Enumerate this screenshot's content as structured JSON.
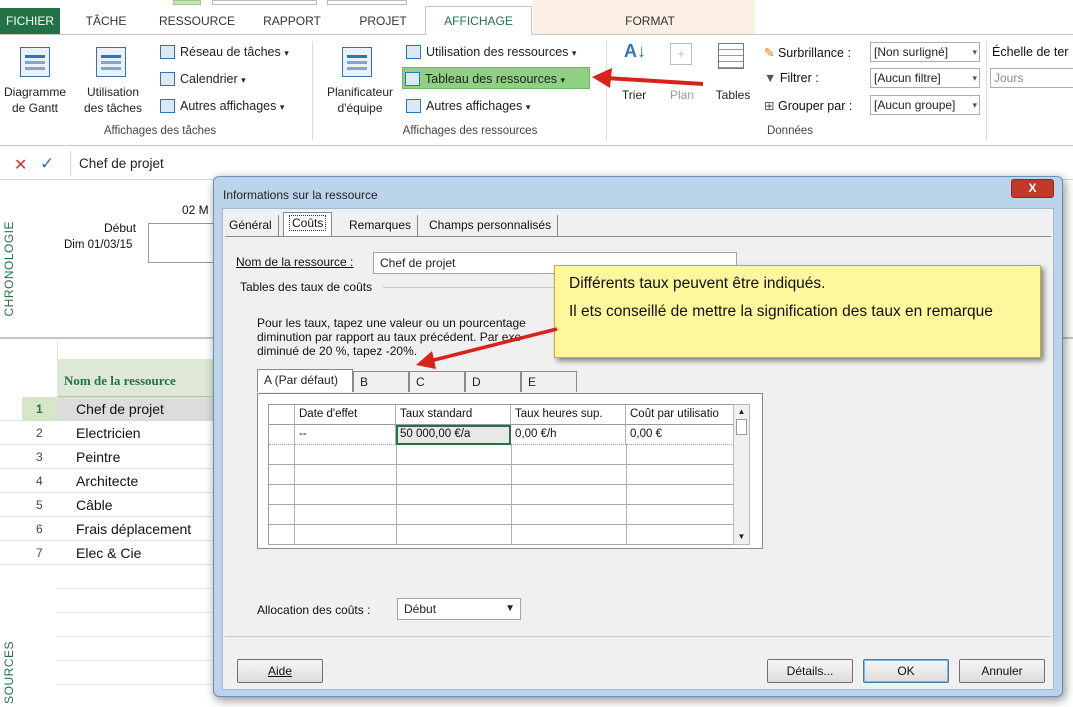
{
  "ribbon": {
    "tabs": [
      "FICHIER",
      "TÂCHE",
      "RESSOURCE",
      "RAPPORT",
      "PROJET",
      "AFFICHAGE",
      "FORMAT"
    ],
    "active_tab": "AFFICHAGE",
    "task_views": {
      "gantt": "Diagramme de Gantt",
      "usage": "Utilisation des tâches",
      "network": "Réseau de tâches",
      "calendar": "Calendrier",
      "other": "Autres affichages",
      "group_label": "Affichages des tâches"
    },
    "resource_views": {
      "planner": "Planificateur d'équipe",
      "usage": "Utilisation des ressources",
      "sheet": "Tableau des ressources",
      "other": "Autres affichages",
      "group_label": "Affichages des ressources"
    },
    "data": {
      "sort": "Trier",
      "outline": "Plan",
      "tables": "Tables",
      "highlight_label": "Surbrillance :",
      "highlight_value": "[Non surligné]",
      "filter_label": "Filtrer :",
      "filter_value": "[Aucun filtre]",
      "group_label_text": "Grouper par :",
      "group_value": "[Aucun groupe]",
      "group_label": "Données"
    },
    "zoom": {
      "timescale_label": "Échelle de ter",
      "timescale_value": "Jours"
    }
  },
  "formula_bar": {
    "value": "Chef de projet"
  },
  "timeline": {
    "side_label": "CHRONOLOGIE",
    "start_label": "Début",
    "start_date": "Dim 01/03/15",
    "date_tick": "02 M"
  },
  "sheet": {
    "side_label": "SOURCES",
    "column_header": "Nom de la ressource",
    "rows": [
      {
        "num": "1",
        "name": "Chef de projet"
      },
      {
        "num": "2",
        "name": "Electricien"
      },
      {
        "num": "3",
        "name": "Peintre"
      },
      {
        "num": "4",
        "name": "Architecte"
      },
      {
        "num": "5",
        "name": "Câble"
      },
      {
        "num": "6",
        "name": "Frais déplacement"
      },
      {
        "num": "7",
        "name": "Elec & Cie"
      }
    ]
  },
  "dialog": {
    "title": "Informations sur la ressource",
    "close": "X",
    "tabs": [
      "Général",
      "Coûts",
      "Remarques",
      "Champs personnalisés"
    ],
    "active_tab": "Coûts",
    "name_label": "Nom de la ressource :",
    "name_value": "Chef de projet",
    "rates_title": "Tables des taux de coûts",
    "help_text_1": "Pour les taux, tapez une valeur ou un pourcentage",
    "help_text_2": "diminution par rapport au taux précédent. Par exe",
    "help_text_3": "diminué de 20 %, tapez -20%.",
    "rate_tabs": [
      "A (Par défaut)",
      "B",
      "C",
      "D",
      "E"
    ],
    "grid": {
      "headers": [
        "Date d'effet",
        "Taux standard",
        "Taux heures sup.",
        "Coût par utilisatio"
      ],
      "row1": [
        "--",
        "50 000,00 €/a",
        "0,00 €/h",
        "0,00 €"
      ]
    },
    "allocation_label": "Allocation des coûts :",
    "allocation_value": "Début",
    "buttons": {
      "help": "Aide",
      "details": "Détails...",
      "ok": "OK",
      "cancel": "Annuler"
    }
  },
  "callout": {
    "line1": "Différents taux peuvent être indiqués.",
    "line2": "Il ets conseillé de mettre la signification des taux en remarque"
  },
  "colors": {
    "accent": "#217346",
    "arrow": "#d9221c",
    "callout_bg": "#fff79b",
    "highlight": "#8fd083"
  }
}
